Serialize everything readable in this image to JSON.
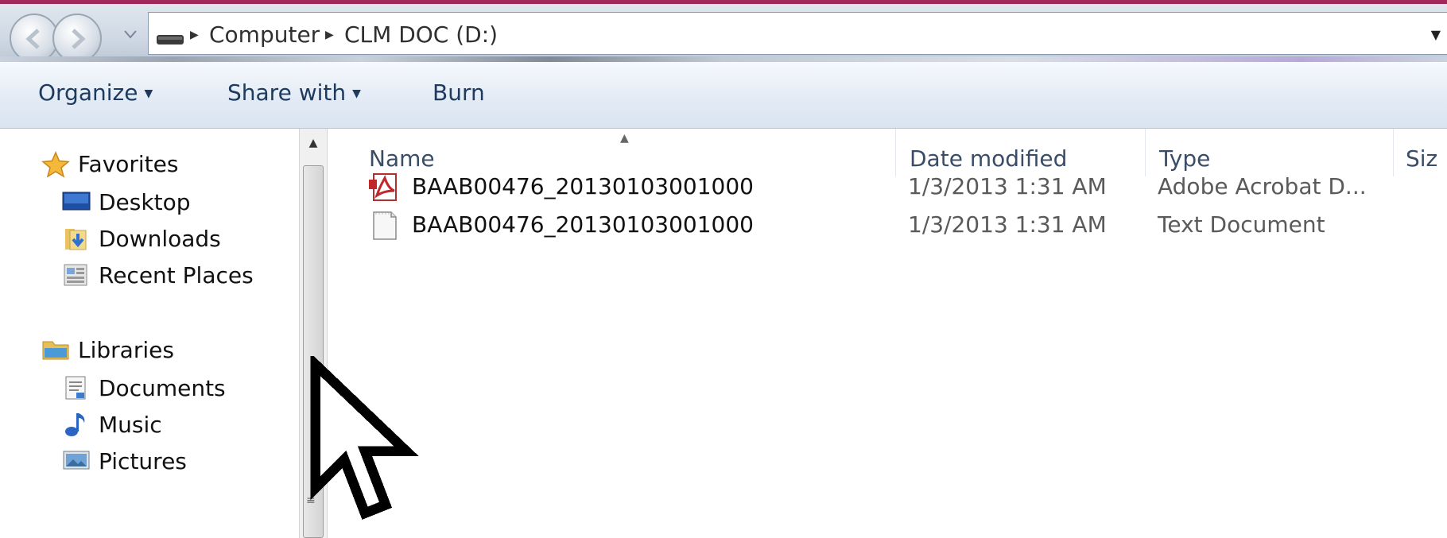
{
  "address_bar": {
    "breadcrumbs": [
      {
        "label": "Computer"
      },
      {
        "label": "CLM DOC (D:)"
      }
    ]
  },
  "command_bar": {
    "organize_label": "Organize",
    "share_label": "Share with",
    "burn_label": "Burn"
  },
  "navigation": {
    "favorites": {
      "label": "Favorites",
      "items": [
        {
          "label": "Desktop",
          "icon": "desktop-icon"
        },
        {
          "label": "Downloads",
          "icon": "downloads-icon"
        },
        {
          "label": "Recent Places",
          "icon": "recent-places-icon"
        }
      ]
    },
    "libraries": {
      "label": "Libraries",
      "items": [
        {
          "label": "Documents",
          "icon": "documents-icon"
        },
        {
          "label": "Music",
          "icon": "music-icon"
        },
        {
          "label": "Pictures",
          "icon": "pictures-icon"
        }
      ]
    }
  },
  "file_list": {
    "columns": [
      {
        "label": "Name"
      },
      {
        "label": "Date modified"
      },
      {
        "label": "Type"
      },
      {
        "label": "Siz"
      }
    ],
    "rows": [
      {
        "name": "BAAB00476_20130103001000",
        "date": "1/3/2013 1:31 AM",
        "type": "Adobe Acrobat D...",
        "icon": "pdf-icon"
      },
      {
        "name": "BAAB00476_20130103001000",
        "date": "1/3/2013 1:31 AM",
        "type": "Text Document",
        "icon": "text-document-icon"
      }
    ]
  },
  "colors": {
    "title_accent": "#a0285a",
    "command_text": "#1e3a5f",
    "header_text": "#3a4d68"
  }
}
